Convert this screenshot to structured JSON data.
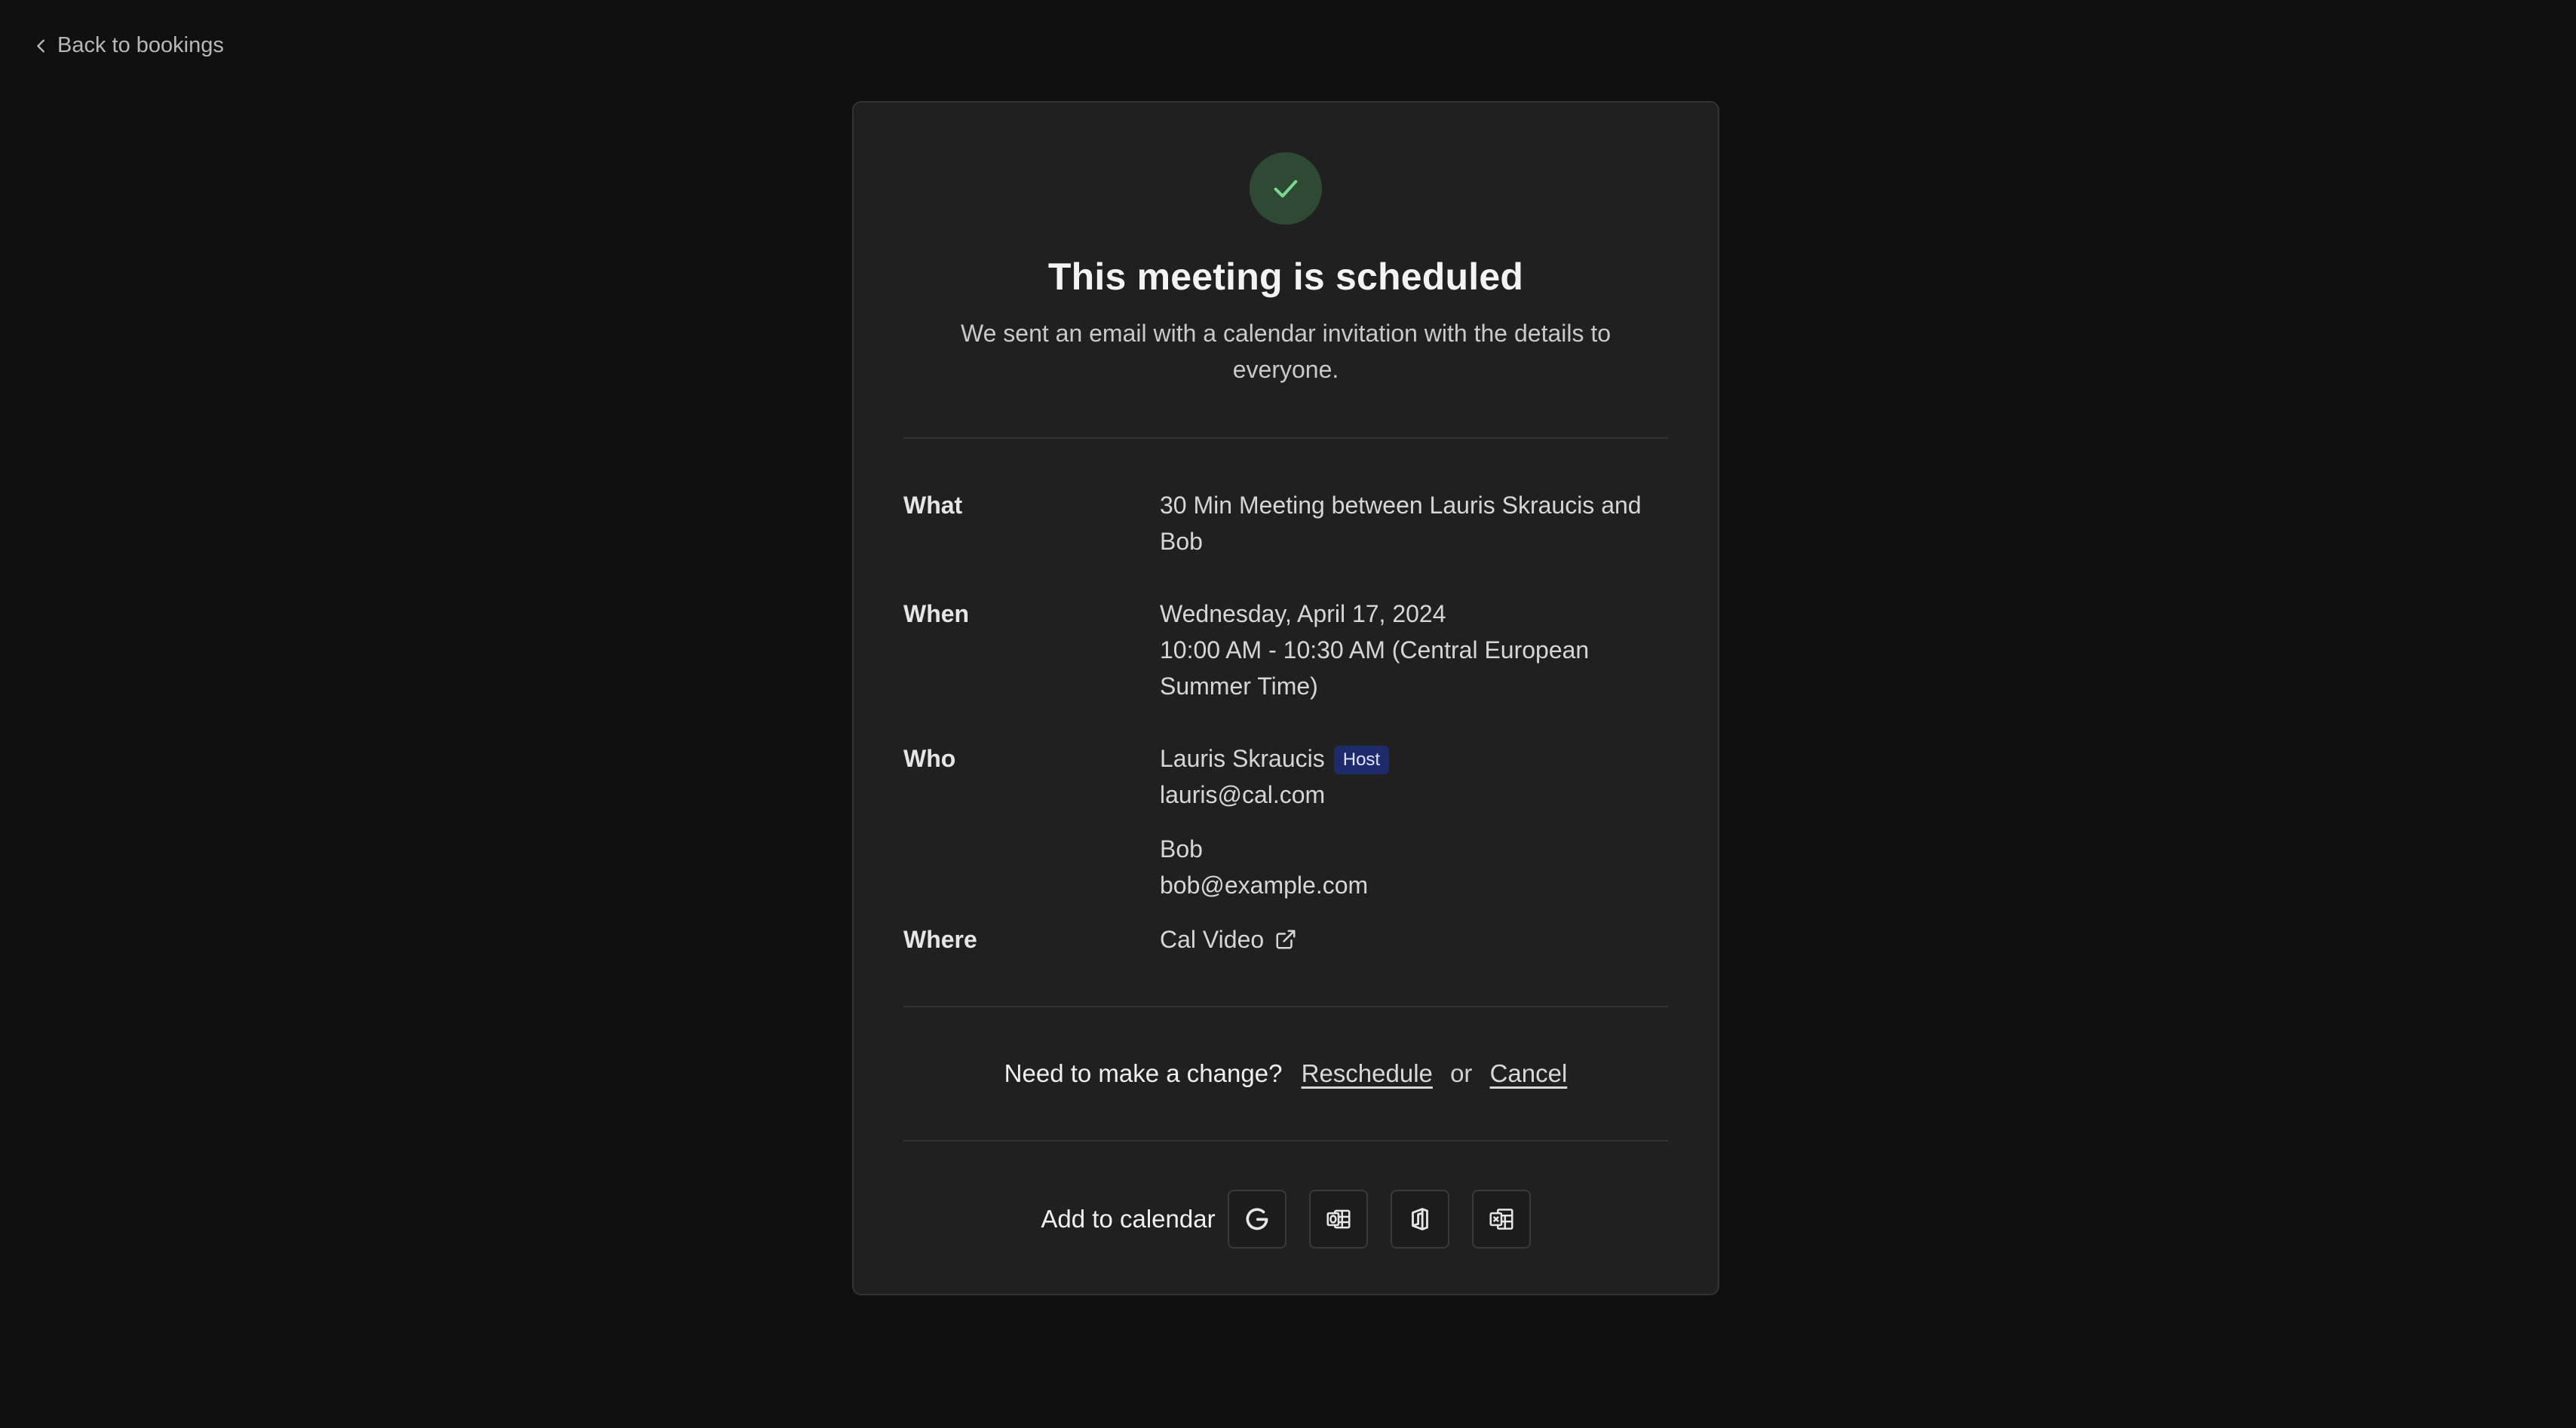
{
  "nav": {
    "back_label": "Back to bookings"
  },
  "header": {
    "title": "This meeting is scheduled",
    "subtitle": "We sent an email with a calendar invitation with the details to everyone."
  },
  "details": {
    "what": {
      "label": "What",
      "value": "30 Min Meeting between Lauris Skraucis and Bob"
    },
    "when": {
      "label": "When",
      "date": "Wednesday, April 17, 2024",
      "time": "10:00 AM - 10:30 AM (Central European Summer Time)"
    },
    "who": {
      "label": "Who",
      "attendees": [
        {
          "name": "Lauris Skraucis",
          "badge": "Host",
          "email": "lauris@cal.com"
        },
        {
          "name": "Bob",
          "email": "bob@example.com"
        }
      ]
    },
    "where": {
      "label": "Where",
      "value": "Cal Video",
      "icon": "external-link-icon"
    }
  },
  "change": {
    "prompt": "Need to make a change?",
    "reschedule": "Reschedule",
    "or": "or",
    "cancel": "Cancel"
  },
  "calendar": {
    "label": "Add to calendar",
    "icons": [
      "google-calendar-icon",
      "microsoft-outlook-icon",
      "office365-icon",
      "ics-file-icon"
    ]
  },
  "colors": {
    "background": "#101010",
    "card": "#202020",
    "success_circle": "#2f4a33",
    "check": "#7bd88f",
    "host_badge": "#1e2a6b"
  }
}
